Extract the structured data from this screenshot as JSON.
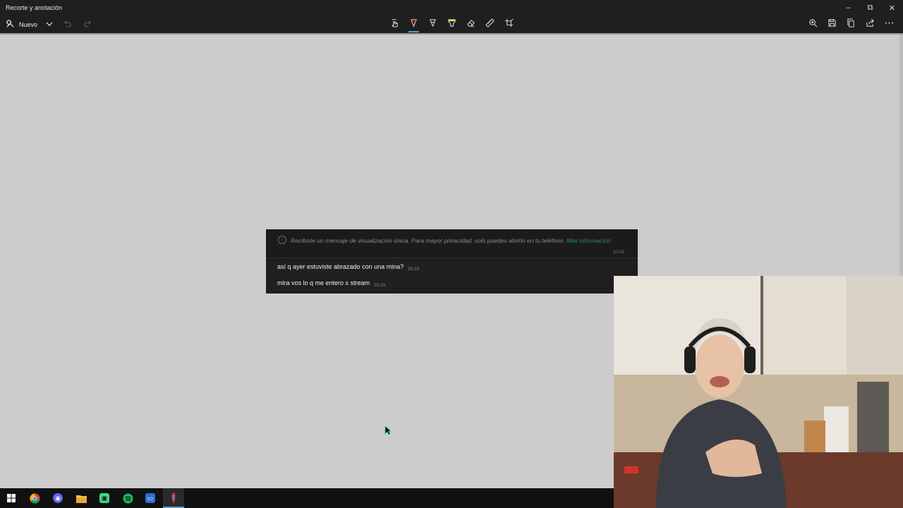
{
  "window": {
    "title": "Recorte y anotación",
    "controls": [
      "minimize-icon",
      "restore-icon",
      "close-icon"
    ]
  },
  "toolbar": {
    "new_label": "Nuevo",
    "left_icons": [
      "new-snip-icon",
      "chevron-down-icon",
      "undo-icon",
      "redo-icon"
    ],
    "center_tools": [
      {
        "icon": "touch-writing-icon"
      },
      {
        "icon": "ballpoint-pen-icon",
        "active": true,
        "color": "#e8202a"
      },
      {
        "icon": "pencil-icon"
      },
      {
        "icon": "highlighter-icon",
        "color": "#f5e142"
      },
      {
        "icon": "eraser-icon"
      },
      {
        "icon": "ruler-icon"
      },
      {
        "icon": "crop-icon"
      }
    ],
    "right_icons": [
      "zoom-icon",
      "save-icon",
      "copy-icon",
      "share-icon",
      "more-icon"
    ]
  },
  "chat": {
    "notice": {
      "text": "Recibiste un mensaje de visualización única. Para mayor privacidad, solo puedes abrirlo en tu teléfono.",
      "link": "Más información",
      "time": "20:02"
    },
    "messages": [
      {
        "text": "así q ayer estuviste abrazado con una mina?",
        "time": "20:15"
      },
      {
        "text": "mira vos lo q me entero x stream",
        "time": "20:15"
      }
    ]
  },
  "taskbar": {
    "icons": [
      "windows-start-icon",
      "chrome-icon",
      "discord-icon",
      "file-explorer-icon",
      "android-app-icon",
      "spotify-icon",
      "remote-desktop-icon",
      "snip-sketch-icon"
    ]
  },
  "colors": {
    "chrome_dark": "#1f1f1f",
    "canvas": "#cccccc",
    "accent": "#4aa3df",
    "link": "#2b8a67"
  }
}
